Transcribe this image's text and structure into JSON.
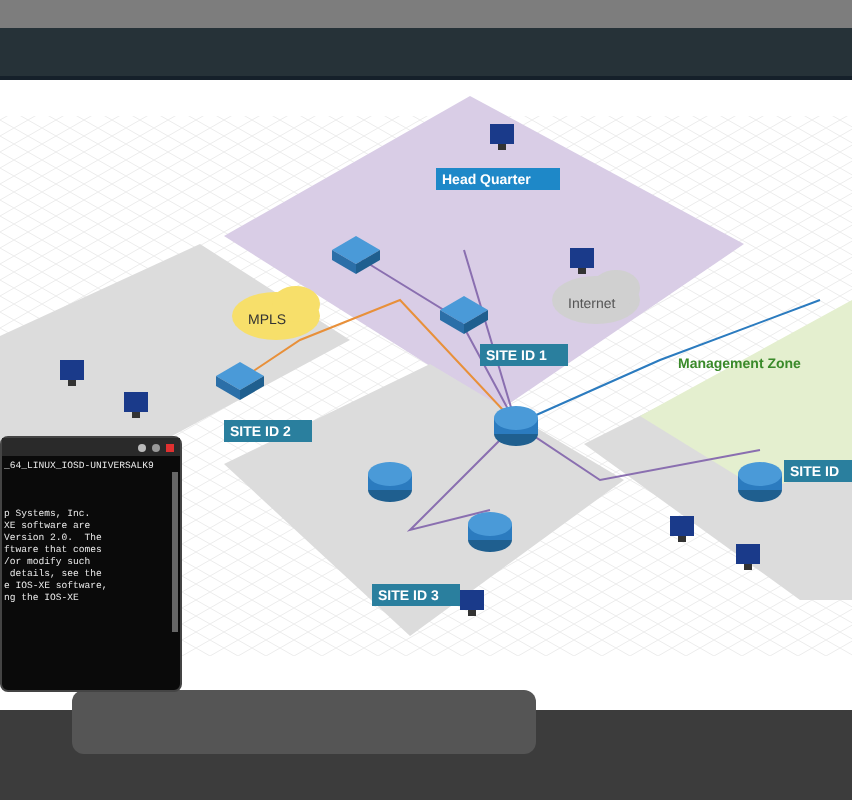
{
  "diagram": {
    "zones": [
      {
        "kind": "hq",
        "label": "Head Quarter"
      },
      {
        "kind": "site1",
        "label": "SITE ID 1"
      },
      {
        "kind": "site2",
        "label": "SITE ID 2"
      },
      {
        "kind": "site3",
        "label": "SITE ID 3"
      },
      {
        "kind": "site4",
        "label": "SITE ID"
      },
      {
        "kind": "mgmt",
        "label": "Management Zone"
      }
    ],
    "clouds": [
      {
        "kind": "mpls",
        "label": "MPLS"
      },
      {
        "kind": "internet",
        "label": "Internet"
      }
    ]
  },
  "terminal": {
    "lines": [
      "_64_LINUX_IOSD-UNIVERSALK9",
      "p Systems, Inc.",
      "XE software are",
      "Version 2.0.  The",
      "ftware that comes",
      "/or modify such",
      " details, see the",
      "e IOS-XE software,",
      "ng the IOS-XE"
    ]
  }
}
